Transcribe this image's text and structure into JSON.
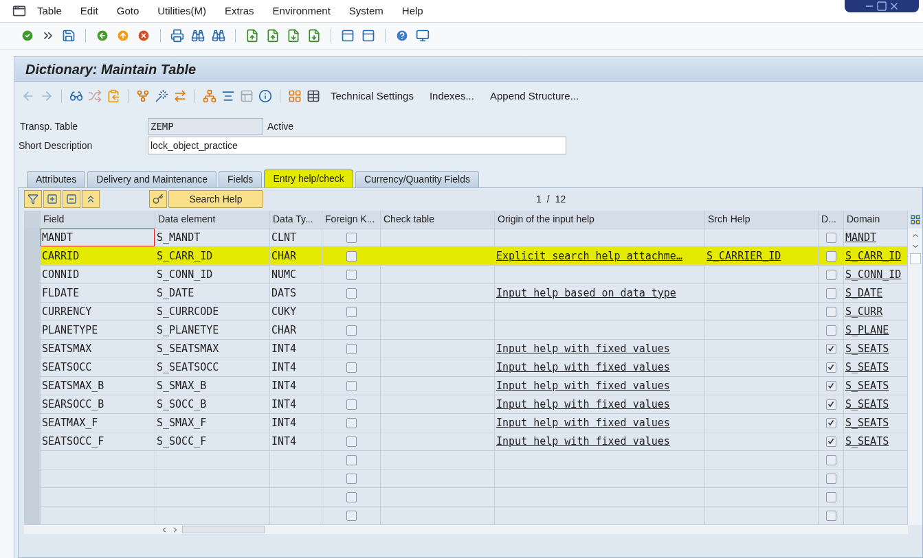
{
  "menu": [
    "Table",
    "Edit",
    "Goto",
    "Utilities(M)",
    "Extras",
    "Environment",
    "System",
    "Help"
  ],
  "title": "Dictionary: Maintain Table",
  "app_toolbar_buttons": [
    "Technical Settings",
    "Indexes...",
    "Append Structure..."
  ],
  "form": {
    "table_label": "Transp. Table",
    "table_value": "ZEMP",
    "status": "Active",
    "desc_label": "Short Description",
    "desc_value": "lock_object_practice"
  },
  "tabs": [
    {
      "label": "Attributes",
      "selected": false,
      "highlighted": false
    },
    {
      "label": "Delivery and Maintenance",
      "selected": false,
      "highlighted": false
    },
    {
      "label": "Fields",
      "selected": false,
      "highlighted": false
    },
    {
      "label": "Entry help/check",
      "selected": true,
      "highlighted": true
    },
    {
      "label": "Currency/Quantity Fields",
      "selected": false,
      "highlighted": false
    }
  ],
  "search_help_button": "Search Help",
  "page_current": "1",
  "page_separator": "/",
  "page_total": "12",
  "table": {
    "columns": [
      "Field",
      "Data element",
      "Data Ty...",
      "Foreign K...",
      "Check table",
      "Origin of the input help",
      "Srch Help",
      "D...",
      "Domain"
    ],
    "rows": [
      {
        "field": "MANDT",
        "data_element": "S_MANDT",
        "data_type": "CLNT",
        "foreign_key": false,
        "d": false,
        "domain": "MANDT",
        "focused": true,
        "highlighted": false
      },
      {
        "field": "CARRID",
        "data_element": "S_CARR_ID",
        "data_type": "CHAR",
        "foreign_key": false,
        "origin": "Explicit search help attachme…",
        "srch_help": "S_CARRIER_ID",
        "d": false,
        "domain": "S_CARR_ID",
        "focused": false,
        "highlighted": true
      },
      {
        "field": "CONNID",
        "data_element": "S_CONN_ID",
        "data_type": "NUMC",
        "foreign_key": false,
        "d": false,
        "domain": "S_CONN_ID",
        "focused": false,
        "highlighted": false
      },
      {
        "field": "FLDATE",
        "data_element": "S_DATE",
        "data_type": "DATS",
        "foreign_key": false,
        "origin": "Input help based on data type",
        "d": false,
        "domain": "S_DATE",
        "focused": false,
        "highlighted": false
      },
      {
        "field": "CURRENCY",
        "data_element": "S_CURRCODE",
        "data_type": "CUKY",
        "foreign_key": false,
        "d": false,
        "domain": "S_CURR",
        "focused": false,
        "highlighted": false
      },
      {
        "field": "PLANETYPE",
        "data_element": "S_PLANETYE",
        "data_type": "CHAR",
        "foreign_key": false,
        "d": false,
        "domain": "S_PLANE",
        "focused": false,
        "highlighted": false
      },
      {
        "field": "SEATSMAX",
        "data_element": "S_SEATSMAX",
        "data_type": "INT4",
        "foreign_key": false,
        "origin": "Input help with fixed values",
        "d": true,
        "domain": "S_SEATS",
        "focused": false,
        "highlighted": false
      },
      {
        "field": "SEATSOCC",
        "data_element": "S_SEATSOCC",
        "data_type": "INT4",
        "foreign_key": false,
        "origin": "Input help with fixed values",
        "d": true,
        "domain": "S_SEATS",
        "focused": false,
        "highlighted": false
      },
      {
        "field": "SEATSMAX_B",
        "data_element": "S_SMAX_B",
        "data_type": "INT4",
        "foreign_key": false,
        "origin": "Input help with fixed values",
        "d": true,
        "domain": "S_SEATS",
        "focused": false,
        "highlighted": false
      },
      {
        "field": "SEARSOCC_B",
        "data_element": "S_SOCC_B",
        "data_type": "INT4",
        "foreign_key": false,
        "origin": "Input help with fixed values",
        "d": true,
        "domain": "S_SEATS",
        "focused": false,
        "highlighted": false
      },
      {
        "field": "SEATMAX_F",
        "data_element": "S_SMAX_F",
        "data_type": "INT4",
        "foreign_key": false,
        "origin": "Input help with fixed values",
        "d": true,
        "domain": "S_SEATS",
        "focused": false,
        "highlighted": false
      },
      {
        "field": "SEATSOCC_F",
        "data_element": "S_SOCC_F",
        "data_type": "INT4",
        "foreign_key": false,
        "origin": "Input help with fixed values",
        "d": true,
        "domain": "S_SEATS",
        "focused": false,
        "highlighted": false
      },
      {
        "foreign_key": false,
        "d": false,
        "focused": false,
        "highlighted": false
      },
      {
        "foreign_key": false,
        "d": false,
        "focused": false,
        "highlighted": false
      },
      {
        "foreign_key": false,
        "d": false,
        "focused": false,
        "highlighted": false
      },
      {
        "foreign_key": false,
        "d": false,
        "focused": false,
        "highlighted": false
      }
    ]
  }
}
